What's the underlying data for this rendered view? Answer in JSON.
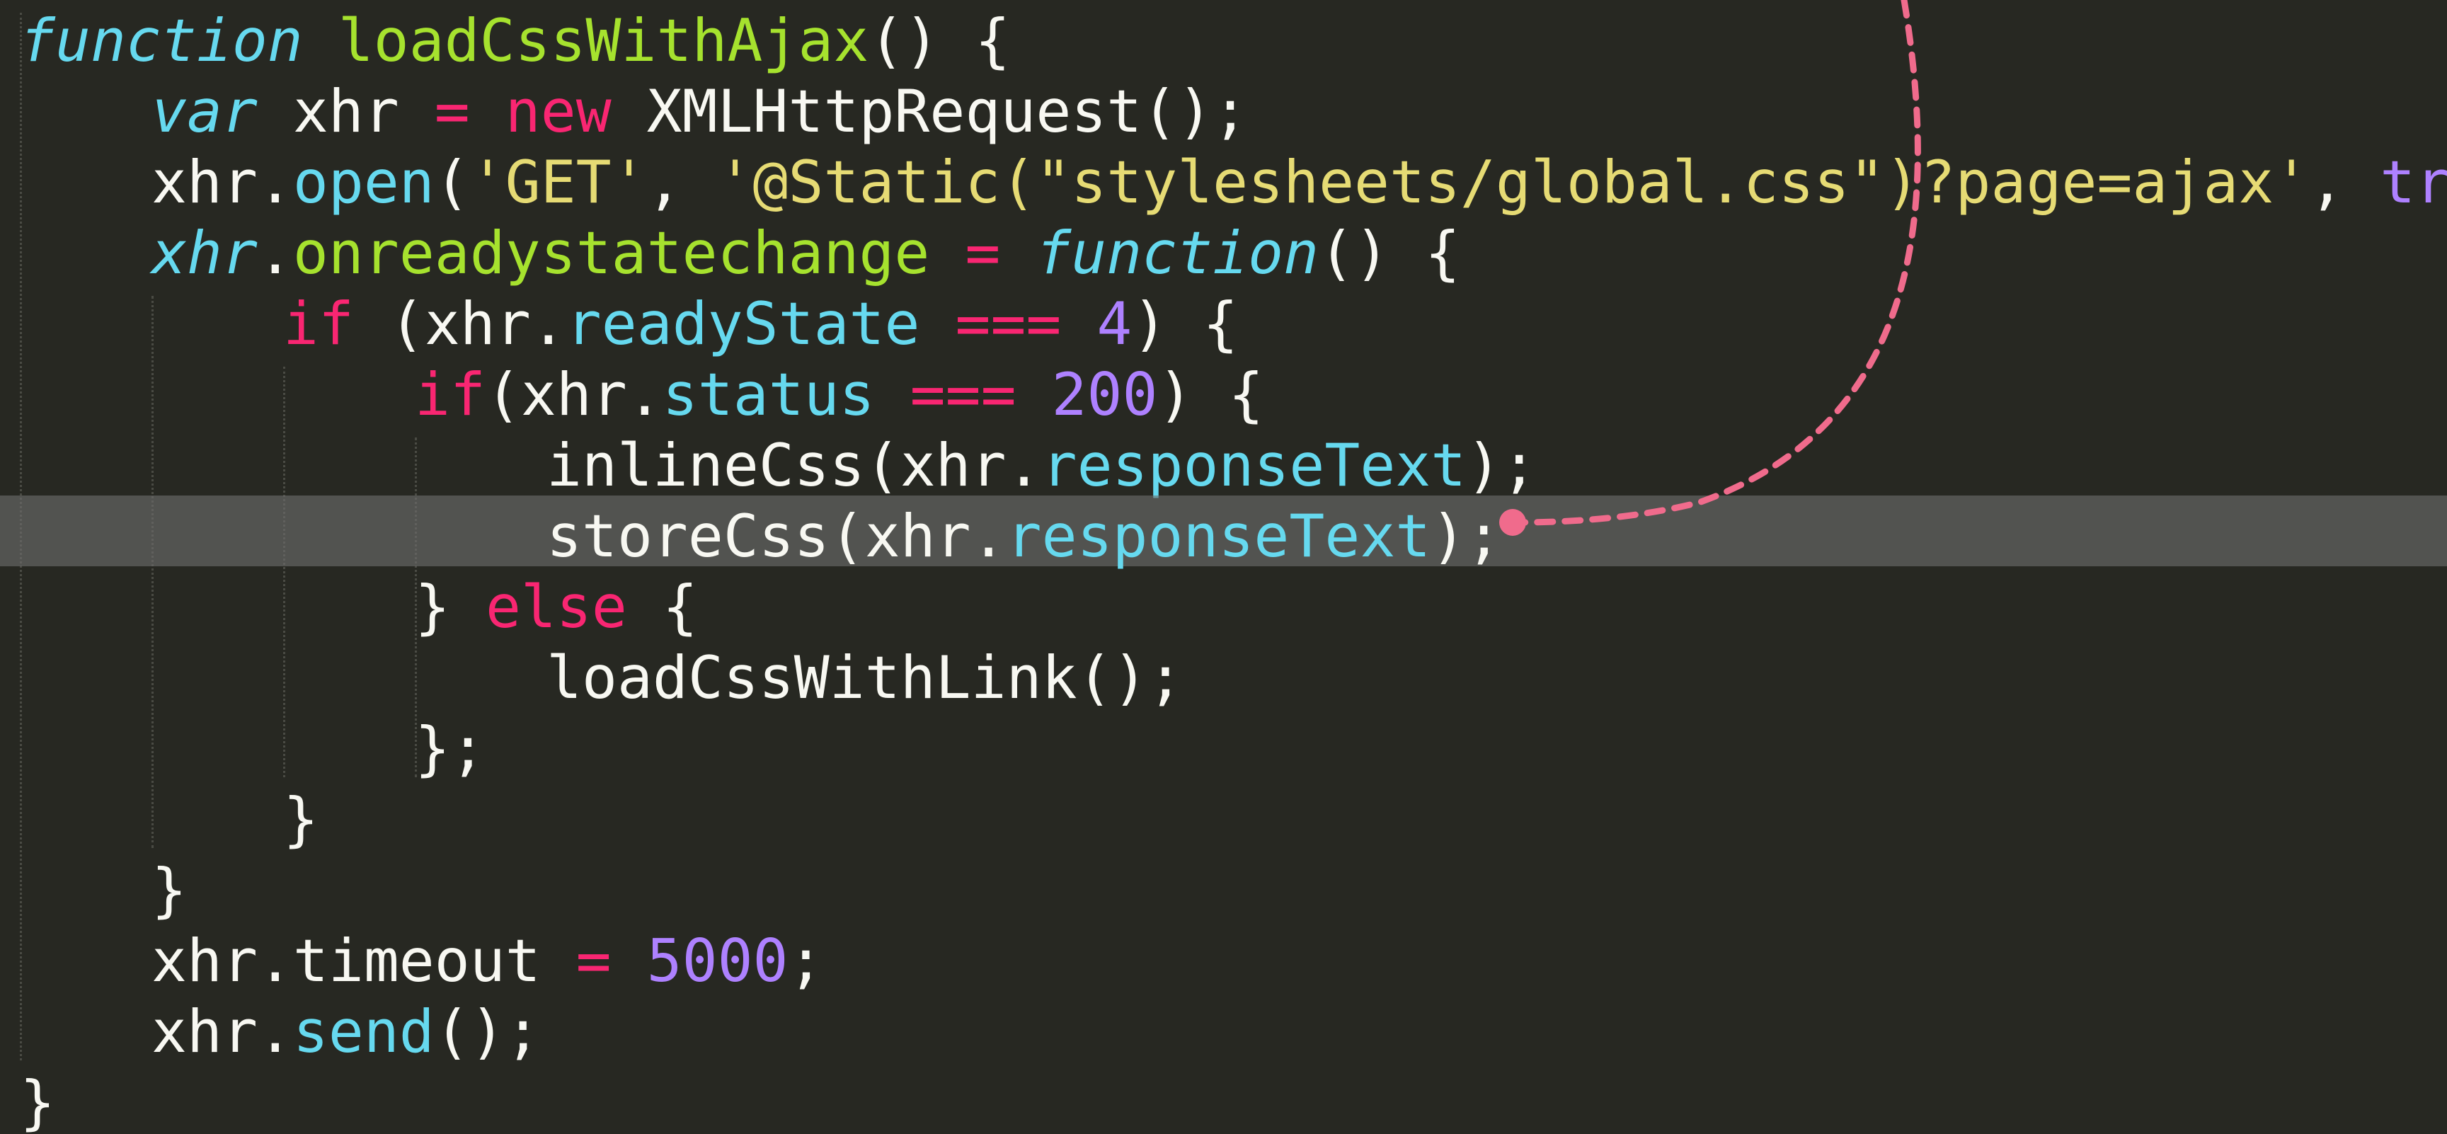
{
  "editor": {
    "theme_colors": {
      "background": "#272822",
      "keyword": "#f92672",
      "string": "#e6db74",
      "number": "#ae81ff",
      "function_name": "#a6e22e",
      "property": "#66d9ef",
      "plain": "#f8f8f2",
      "annotation_arrow": "#f06b8c"
    },
    "highlighted_line": 8,
    "annotation": "dashed-arrow-icon",
    "lines": [
      [
        {
          "t": "function",
          "c": "i"
        },
        {
          "t": " "
        },
        {
          "t": "loadCssWithAjax",
          "c": "f"
        },
        {
          "t": "() {"
        }
      ],
      [
        {
          "t": "var",
          "c": "i"
        },
        {
          "t": " xhr "
        },
        {
          "t": "=",
          "c": "k"
        },
        {
          "t": " "
        },
        {
          "t": "new",
          "c": "k"
        },
        {
          "t": " XMLHttpRequest();"
        }
      ],
      [
        {
          "t": "xhr."
        },
        {
          "t": "open",
          "c": "p"
        },
        {
          "t": "("
        },
        {
          "t": "'GET'",
          "c": "s"
        },
        {
          "t": ", "
        },
        {
          "t": "'@Static(\"stylesheets/global.css\")?page=ajax'",
          "c": "s"
        },
        {
          "t": ", "
        },
        {
          "t": "true",
          "c": "n"
        },
        {
          "t": ");"
        }
      ],
      [
        {
          "t": "xhr",
          "c": "i"
        },
        {
          "t": "."
        },
        {
          "t": "onreadystatechange",
          "c": "f"
        },
        {
          "t": " "
        },
        {
          "t": "=",
          "c": "k"
        },
        {
          "t": " "
        },
        {
          "t": "function",
          "c": "i"
        },
        {
          "t": "() {"
        }
      ],
      [
        {
          "t": "if",
          "c": "k"
        },
        {
          "t": " (xhr."
        },
        {
          "t": "readyState",
          "c": "p"
        },
        {
          "t": " "
        },
        {
          "t": "===",
          "c": "k"
        },
        {
          "t": " "
        },
        {
          "t": "4",
          "c": "n"
        },
        {
          "t": ") {"
        }
      ],
      [
        {
          "t": "if",
          "c": "k"
        },
        {
          "t": "(xhr."
        },
        {
          "t": "status",
          "c": "p"
        },
        {
          "t": " "
        },
        {
          "t": "===",
          "c": "k"
        },
        {
          "t": " "
        },
        {
          "t": "200",
          "c": "n"
        },
        {
          "t": ") {"
        }
      ],
      [
        {
          "t": "inlineCss(xhr."
        },
        {
          "t": "responseText",
          "c": "p"
        },
        {
          "t": ");"
        }
      ],
      [
        {
          "t": "storeCss(xhr."
        },
        {
          "t": "responseText",
          "c": "p"
        },
        {
          "t": ");"
        }
      ],
      [
        {
          "t": "} "
        },
        {
          "t": "else",
          "c": "k"
        },
        {
          "t": " {"
        }
      ],
      [
        {
          "t": "loadCssWithLink();"
        }
      ],
      [
        {
          "t": "};"
        }
      ],
      [
        {
          "t": "}"
        }
      ],
      [
        {
          "t": "}"
        }
      ],
      [
        {
          "t": "xhr.timeout "
        },
        {
          "t": "=",
          "c": "k"
        },
        {
          "t": " "
        },
        {
          "t": "5000",
          "c": "n"
        },
        {
          "t": ";"
        }
      ],
      [
        {
          "t": "xhr."
        },
        {
          "t": "send",
          "c": "p"
        },
        {
          "t": "();"
        }
      ],
      [
        {
          "t": "}"
        }
      ]
    ]
  }
}
